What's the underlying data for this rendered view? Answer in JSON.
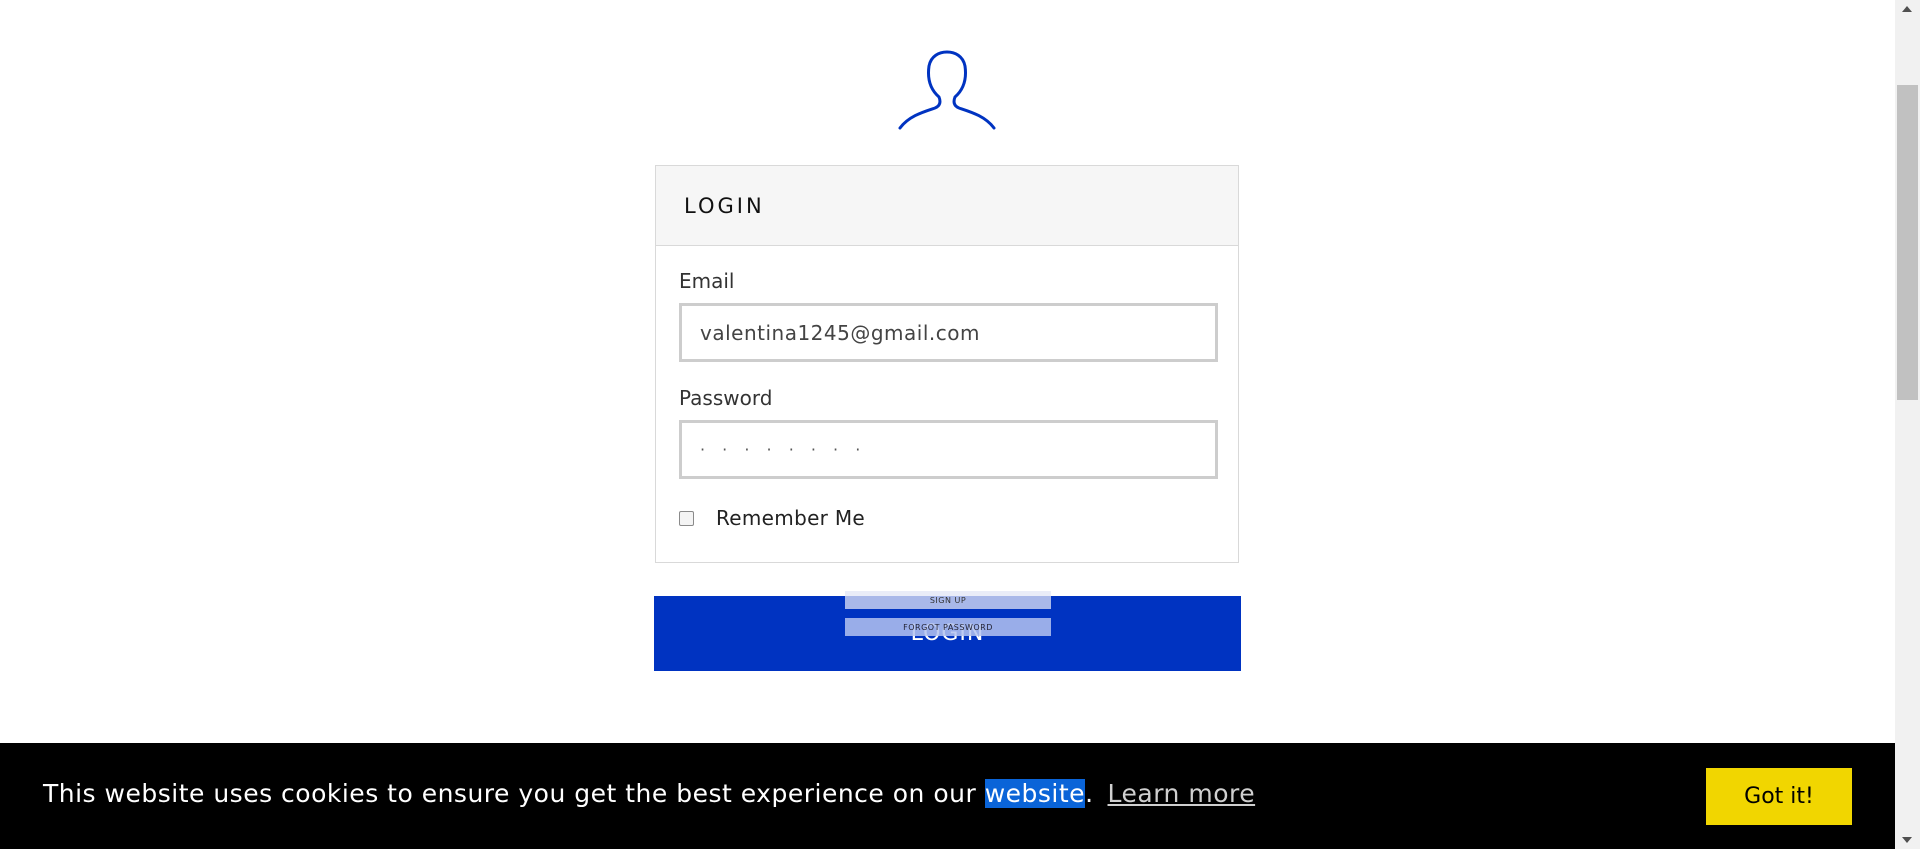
{
  "avatar": {
    "icon": "user-silhouette-icon",
    "color": "#0033c1"
  },
  "login_panel": {
    "title": "LOGIN",
    "email": {
      "label": "Email",
      "value": "valentina1245@gmail.com"
    },
    "password": {
      "label": "Password",
      "value": "· · · · · · · ·"
    },
    "remember": {
      "label": "Remember Me",
      "checked": false
    }
  },
  "login_button": {
    "label": "LOGIN",
    "color": "#0033c1"
  },
  "overlay_links": {
    "signup": "SIGN UP",
    "forgot": "FORGOT PASSWORD"
  },
  "cookie_banner": {
    "text_before": "This website uses cookies to ensure you get the best experience on our ",
    "highlighted": "website",
    "text_after": ".",
    "learn_more": "Learn more",
    "accept": "Got it!",
    "accept_color": "#f1d600"
  }
}
